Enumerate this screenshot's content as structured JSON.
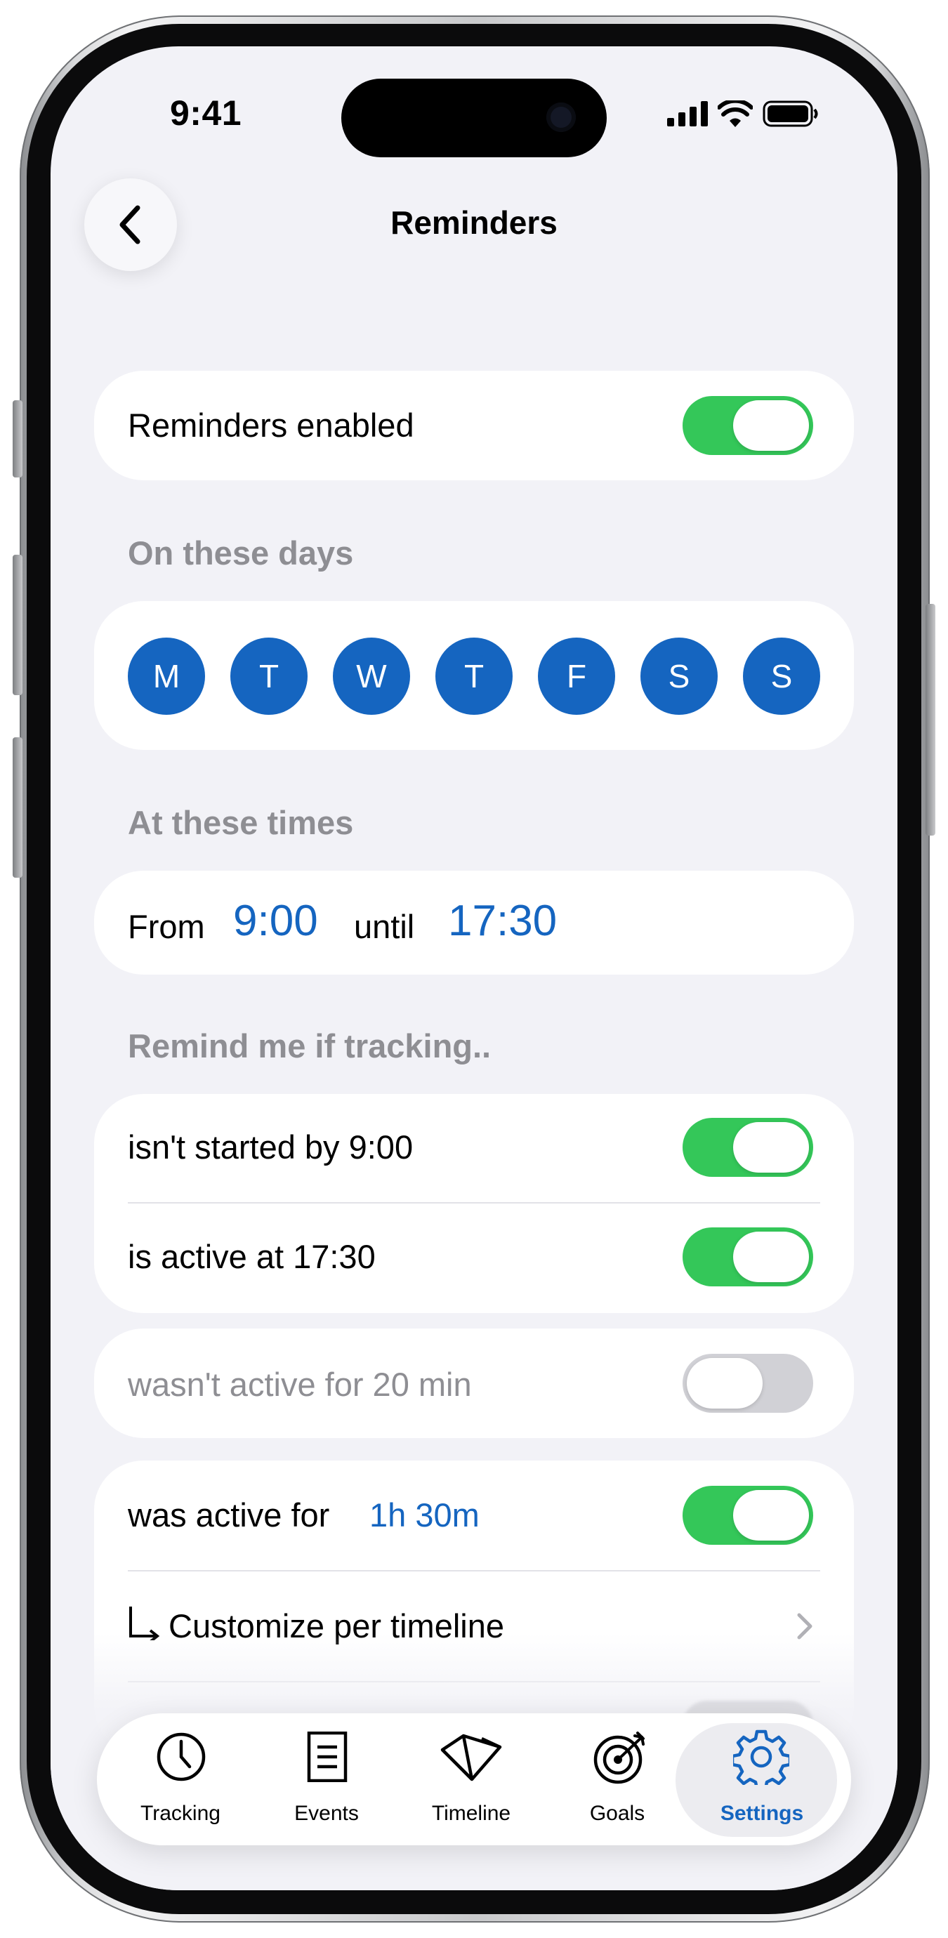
{
  "status_bar": {
    "time": "9:41"
  },
  "nav": {
    "title": "Reminders",
    "back_icon": "chevron-left-icon"
  },
  "master": {
    "label": "Reminders enabled",
    "enabled": true
  },
  "days": {
    "label": "On these days",
    "items": [
      "M",
      "T",
      "W",
      "T",
      "F",
      "S",
      "S"
    ]
  },
  "times": {
    "label": "At these times",
    "from_label": "From",
    "from_value": "9:00",
    "until_label": "until",
    "until_value": "17:30"
  },
  "remind": {
    "label": "Remind me if tracking..",
    "not_started": {
      "label": "isn't started by 9:00",
      "enabled": true
    },
    "active_at": {
      "label": "is active at 17:30",
      "enabled": true
    },
    "inactive_for": {
      "label": "wasn't active for 20 min",
      "enabled": false
    },
    "active_for": {
      "label": "was active for",
      "value": "1h 30m",
      "enabled": true
    },
    "customize": {
      "label": "Customize per timeline"
    }
  },
  "tabbar": {
    "items": [
      {
        "label": "Tracking",
        "icon": "clock-icon"
      },
      {
        "label": "Events",
        "icon": "list-icon"
      },
      {
        "label": "Timeline",
        "icon": "timeline-icon"
      },
      {
        "label": "Goals",
        "icon": "target-icon"
      },
      {
        "label": "Settings",
        "icon": "gear-icon"
      }
    ],
    "active": "Settings"
  },
  "colors": {
    "accent": "#1565c0",
    "toggle_on": "#34c759",
    "background": "#f2f2f7"
  }
}
